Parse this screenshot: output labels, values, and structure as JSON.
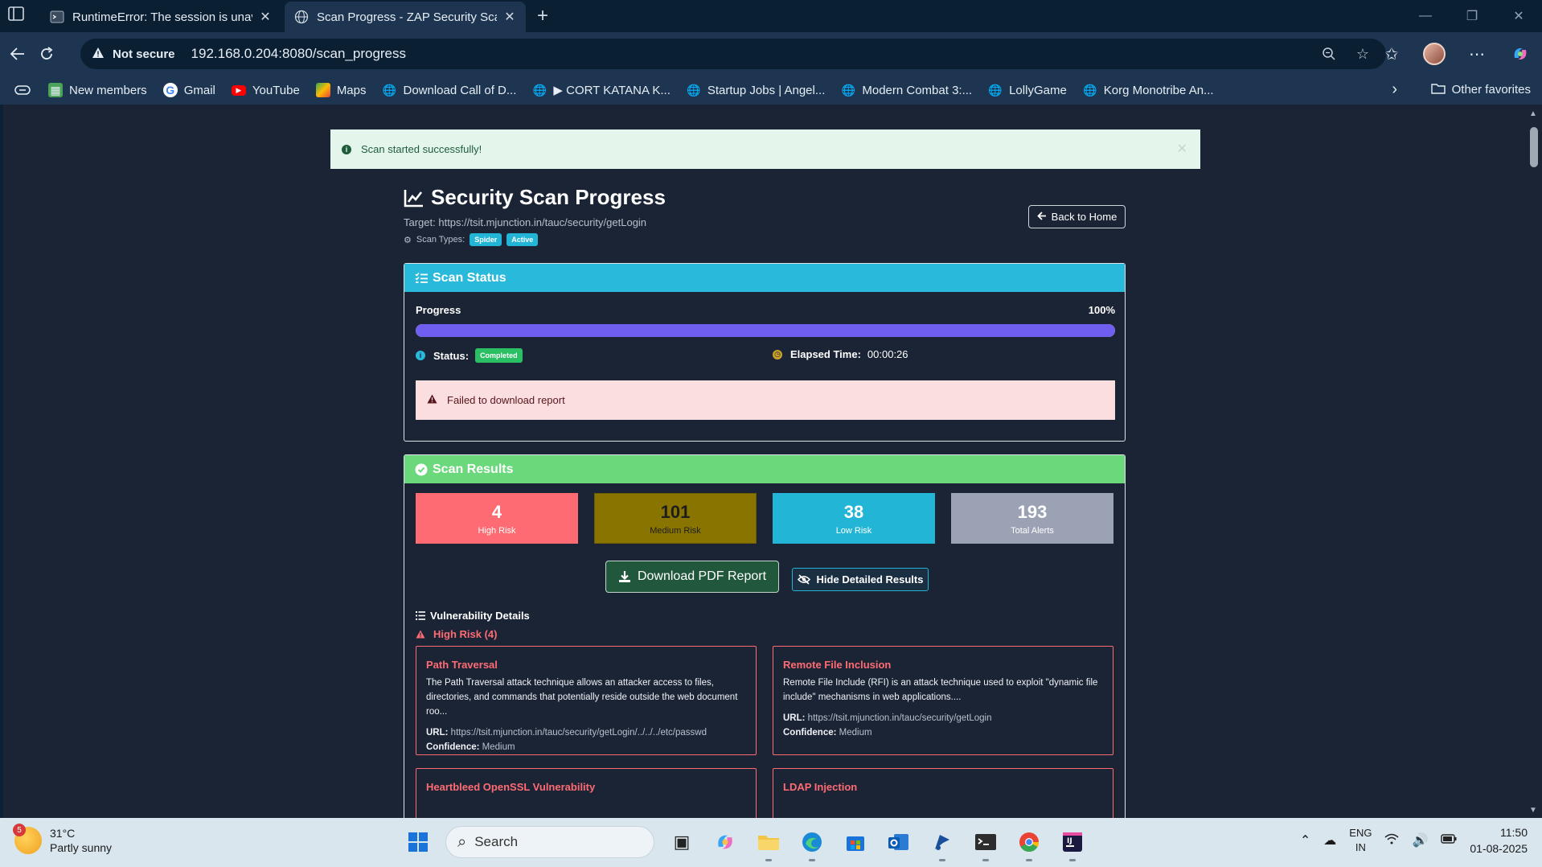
{
  "browser": {
    "tabs": [
      {
        "title": "RuntimeError: The session is unav",
        "icon": "terminal-icon"
      },
      {
        "title": "Scan Progress - ZAP Security Scan",
        "icon": "globe-icon"
      }
    ],
    "address": {
      "security_label": "Not secure",
      "url": "192.168.0.204:8080/scan_progress"
    },
    "favorites": [
      {
        "label": "New members",
        "icon": "app-icon"
      },
      {
        "label": "Gmail",
        "icon": "google-icon"
      },
      {
        "label": "YouTube",
        "icon": "youtube-icon"
      },
      {
        "label": "Maps",
        "icon": "maps-icon"
      },
      {
        "label": "Download Call of D...",
        "icon": "globe-icon"
      },
      {
        "label": "▶ CORT KATANA K...",
        "icon": "globe-icon"
      },
      {
        "label": "Startup Jobs | Angel...",
        "icon": "globe-icon"
      },
      {
        "label": "Modern Combat 3:...",
        "icon": "globe-icon"
      },
      {
        "label": "LollyGame",
        "icon": "globe-icon"
      },
      {
        "label": "Korg Monotribe An...",
        "icon": "globe-icon"
      }
    ],
    "other_favorites": "Other favorites"
  },
  "page": {
    "success_alert": "Scan started successfully!",
    "title": "Security Scan Progress",
    "target": "Target: https://tsit.mjunction.in/tauc/security/getLogin",
    "scan_types_label": "Scan Types:",
    "scan_types": [
      "Spider",
      "Active"
    ],
    "back_button": "Back to Home",
    "status_card": {
      "header": "Scan Status",
      "progress_label": "Progress",
      "progress_text": "100%",
      "progress_value": 1.0,
      "status_label": "Status:",
      "status_value": "Completed",
      "elapsed_label": "Elapsed Time:",
      "elapsed_value": "00:00:26",
      "error_alert": "Failed to download report"
    },
    "results_card": {
      "header": "Scan Results",
      "stats": [
        {
          "value": "4",
          "label": "High Risk"
        },
        {
          "value": "101",
          "label": "Medium Risk"
        },
        {
          "value": "38",
          "label": "Low Risk"
        },
        {
          "value": "193",
          "label": "Total Alerts"
        }
      ],
      "download_button": "Download PDF Report",
      "hide_button": "Hide Detailed Results",
      "vuln_heading": "Vulnerability Details",
      "high_risk_heading": "High Risk (4)",
      "url_label": "URL:",
      "confidence_label": "Confidence:",
      "vulns": [
        {
          "title": "Path Traversal",
          "description": "The Path Traversal attack technique allows an attacker access to files, directories, and commands that potentially reside outside the web document roo...",
          "url": "https://tsit.mjunction.in/tauc/security/getLogin/../../../etc/passwd",
          "confidence": "Medium"
        },
        {
          "title": "Remote File Inclusion",
          "description": "Remote File Include (RFI) is an attack technique used to exploit \"dynamic file include\" mechanisms in web applications....",
          "url": "https://tsit.mjunction.in/tauc/security/getLogin",
          "confidence": "Medium"
        },
        {
          "title": "Heartbleed OpenSSL Vulnerability"
        },
        {
          "title": "LDAP Injection"
        }
      ]
    }
  },
  "taskbar": {
    "weather": {
      "badge": "5",
      "temp": "31°C",
      "desc": "Partly sunny"
    },
    "search_placeholder": "Search",
    "lang": "ENG",
    "region": "IN",
    "time": "11:50",
    "date": "01-08-2025"
  },
  "colors": {
    "page_bg": "#1b2435",
    "status_header": "#29b9da",
    "results_header": "#6bd87c",
    "high_risk": "#ff6b73",
    "medium_risk": "#8a7400",
    "low_risk": "#22b5d6",
    "total": "#9aa2b4",
    "progress": "#6f5ef0"
  }
}
